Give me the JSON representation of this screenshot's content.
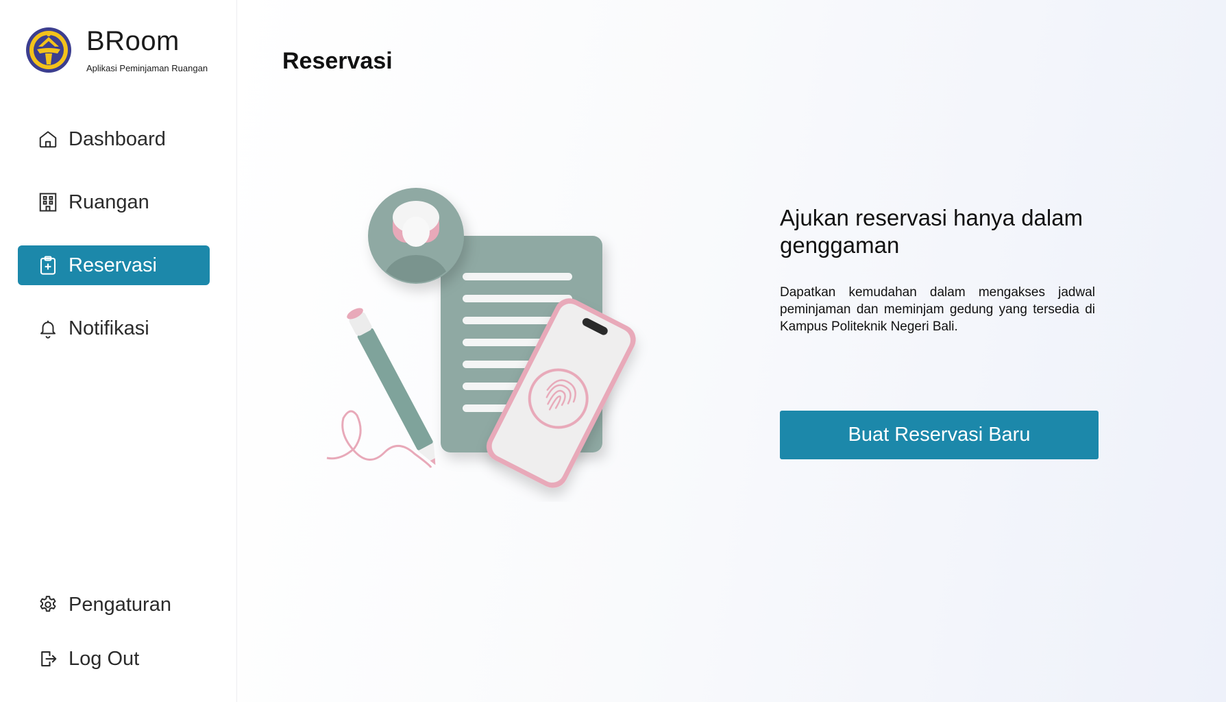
{
  "brand": {
    "name": "BRoom",
    "subtitle": "Aplikasi Peminjaman Ruangan"
  },
  "nav": {
    "items": [
      {
        "label": "Dashboard",
        "icon": "home-icon"
      },
      {
        "label": "Ruangan",
        "icon": "building-icon"
      },
      {
        "label": "Reservasi",
        "icon": "clipboard-plus-icon",
        "active": true
      },
      {
        "label": "Notifikasi",
        "icon": "bell-icon"
      }
    ],
    "bottom": [
      {
        "label": "Pengaturan",
        "icon": "gear-icon"
      },
      {
        "label": "Log Out",
        "icon": "logout-icon"
      }
    ]
  },
  "page": {
    "title": "Reservasi"
  },
  "hero": {
    "headline": "Ajukan reservasi hanya dalam genggaman",
    "description": "Dapatkan kemudahan dalam mengakses jadwal peminjaman dan meminjam gedung yang tersedia di Kampus Politeknik Negeri Bali.",
    "button_label": "Buat Reservasi Baru"
  },
  "colors": {
    "accent": "#1c88aa",
    "illustration_green": "#8fa9a3",
    "illustration_pink": "#e8a9b9"
  }
}
